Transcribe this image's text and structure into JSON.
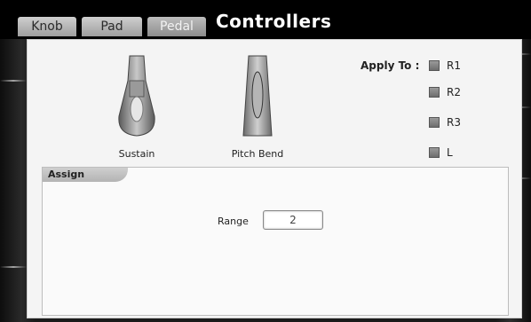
{
  "tabs": [
    {
      "label": "Knob",
      "active": false
    },
    {
      "label": "Pad",
      "active": false
    },
    {
      "label": "Pedal",
      "active": true
    }
  ],
  "title": "Controllers",
  "controls": [
    {
      "label": "Sustain",
      "icon": "sustain-pedal-icon"
    },
    {
      "label": "Pitch Bend",
      "icon": "pitch-bend-pedal-icon"
    }
  ],
  "apply_to": {
    "label": "Apply To :",
    "options": [
      {
        "label": "R1",
        "checked": false
      },
      {
        "label": "R2",
        "checked": false
      },
      {
        "label": "R3",
        "checked": false
      },
      {
        "label": "L",
        "checked": false
      }
    ]
  },
  "assign": {
    "label": "Assign",
    "range_label": "Range",
    "range_value": "2"
  },
  "colors": {
    "tabbar": "#000000",
    "panel": "#f4f4f4",
    "checkbox": "#8a8a8a"
  }
}
